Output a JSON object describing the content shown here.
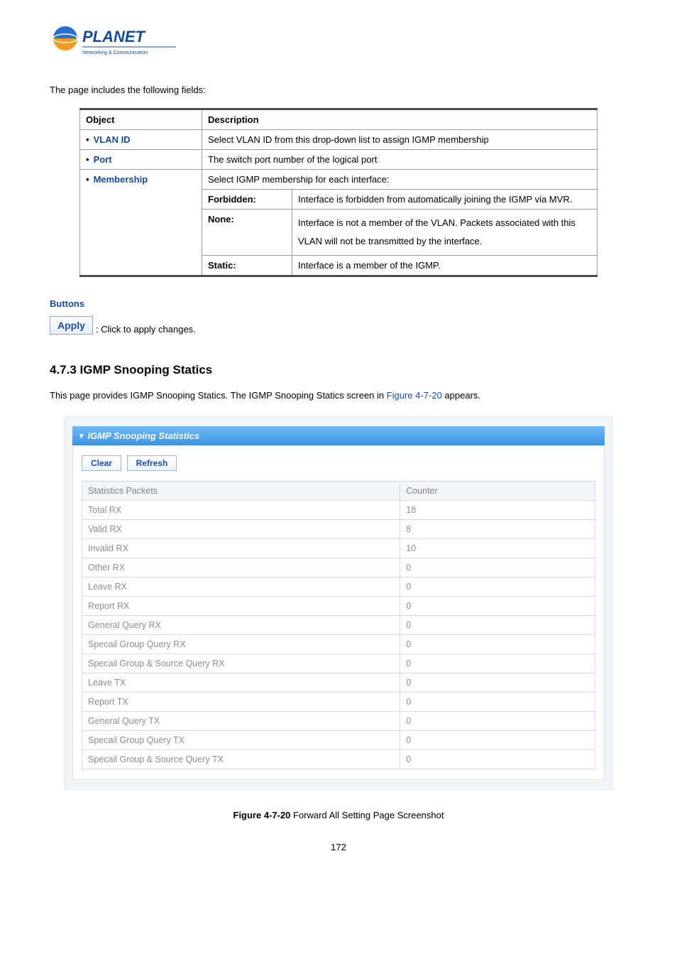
{
  "logo": {
    "brand": "PLANET",
    "sub": "Networking & Communication"
  },
  "intro": "The page includes the following fields:",
  "obj_table": {
    "headers": {
      "object": "Object",
      "description": "Description"
    },
    "rows": [
      {
        "obj": "VLAN ID",
        "desc": "Select VLAN ID from this drop-down list to assign IGMP membership"
      },
      {
        "obj": "Port",
        "desc": "The switch port number of the logical port"
      },
      {
        "obj": "Membership",
        "desc": "Select IGMP membership for each interface:"
      }
    ],
    "sub": [
      {
        "label": "Forbidden:",
        "desc": "Interface is forbidden from automatically joining the IGMP via MVR."
      },
      {
        "label": "None:",
        "desc": "Interface is not a member of the VLAN. Packets associated with this VLAN will not be transmitted by the interface."
      },
      {
        "label": "Static:",
        "desc": "Interface is a member of the IGMP."
      }
    ]
  },
  "buttons": {
    "heading": "Buttons",
    "apply": "Apply",
    "apply_desc": ": Click to apply changes."
  },
  "section": {
    "number": "4.7.3",
    "title": "IGMP Snooping Statics",
    "intro_pre": "This page provides IGMP Snooping Statics. The IGMP Snooping Statics screen in ",
    "figref": "Figure 4-7-20",
    "intro_post": " appears."
  },
  "panel": {
    "title": "IGMP Snooping Statistics",
    "btn_clear": "Clear",
    "btn_refresh": "Refresh",
    "headers": {
      "packets": "Statistics Packets",
      "counter": "Counter"
    },
    "rows": [
      {
        "label": "Total RX",
        "value": "18"
      },
      {
        "label": "Valid RX",
        "value": "8"
      },
      {
        "label": "Invalid RX",
        "value": "10"
      },
      {
        "label": "Other RX",
        "value": "0"
      },
      {
        "label": "Leave RX",
        "value": "0"
      },
      {
        "label": "Report RX",
        "value": "0"
      },
      {
        "label": "General Query RX",
        "value": "0"
      },
      {
        "label": "Specail Group Query RX",
        "value": "0"
      },
      {
        "label": "Specail Group & Source Query RX",
        "value": "0"
      },
      {
        "label": "Leave TX",
        "value": "0"
      },
      {
        "label": "Report TX",
        "value": "0"
      },
      {
        "label": "General Query TX",
        "value": "0"
      },
      {
        "label": "Specail Group Query TX",
        "value": "0"
      },
      {
        "label": "Specail Group & Source Query TX",
        "value": "0"
      }
    ]
  },
  "figure": {
    "label": "Figure 4-7-20",
    "caption": " Forward All Setting Page Screenshot"
  },
  "page_number": "172"
}
